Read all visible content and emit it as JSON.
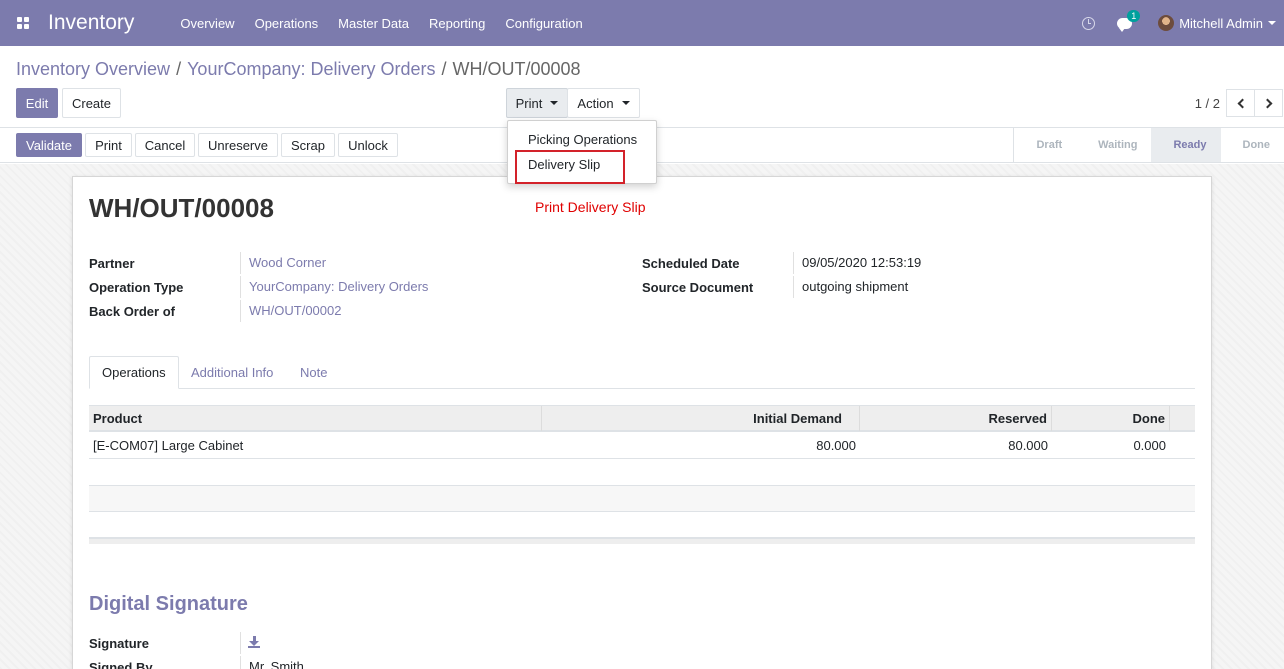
{
  "navbar": {
    "app_name": "Inventory",
    "menu": [
      "Overview",
      "Operations",
      "Master Data",
      "Reporting",
      "Configuration"
    ],
    "chat_badge": "1",
    "user_name": "Mitchell Admin"
  },
  "breadcrumb": {
    "items": [
      "Inventory Overview",
      "YourCompany: Delivery Orders"
    ],
    "separator": "/",
    "current": "WH/OUT/00008"
  },
  "buttons": {
    "edit": "Edit",
    "create": "Create",
    "print": "Print",
    "action": "Action"
  },
  "print_menu": {
    "items": [
      "Picking Operations",
      "Delivery Slip"
    ]
  },
  "pager": {
    "text": "1 / 2"
  },
  "header_buttons": {
    "validate": "Validate",
    "print": "Print",
    "cancel": "Cancel",
    "unreserve": "Unreserve",
    "scrap": "Scrap",
    "unlock": "Unlock"
  },
  "stages": [
    "Draft",
    "Waiting",
    "Ready",
    "Done"
  ],
  "active_stage": "Ready",
  "record": {
    "title": "WH/OUT/00008",
    "annotation": "Print Delivery Slip",
    "fields_left": [
      {
        "label": "Partner",
        "value": "Wood Corner"
      },
      {
        "label": "Operation Type",
        "value": "YourCompany: Delivery Orders"
      },
      {
        "label": "Back Order of",
        "value": "WH/OUT/00002"
      }
    ],
    "fields_right": [
      {
        "label": "Scheduled Date",
        "value": "09/05/2020 12:53:19"
      },
      {
        "label": "Source Document",
        "value": "outgoing shipment"
      }
    ]
  },
  "tabs": [
    "Operations",
    "Additional Info",
    "Note"
  ],
  "table": {
    "columns": [
      "Product",
      "Initial Demand",
      "Reserved",
      "Done"
    ],
    "rows": [
      [
        "[E-COM07] Large Cabinet",
        "80.000",
        "80.000",
        "0.000"
      ]
    ]
  },
  "signature": {
    "section_title": "Digital Signature",
    "signature_label": "Signature",
    "signed_by_label": "Signed By",
    "signed_by_value": "Mr. Smith"
  },
  "colors": {
    "brand": "#7c7bad",
    "highlight": "#d3222a",
    "annotation": "#e00000"
  }
}
